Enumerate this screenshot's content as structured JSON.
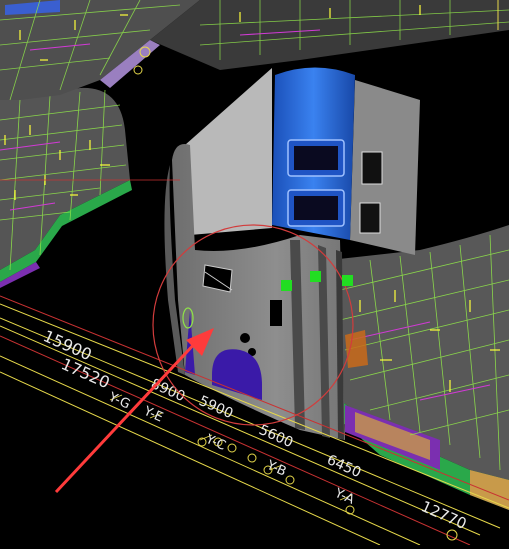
{
  "viewport": {
    "background": "#000000",
    "colors": {
      "slab_top": "#5a5a5a",
      "slab_edge_green": "#2ecc40",
      "grid_green": "#8fe34a",
      "grid_yellow": "#ffff3a",
      "grid_magenta": "#d23ad6",
      "wall_gray": "#8c8c8c",
      "wall_light": "#bdbdbd",
      "shaft_blue": "#2f6fe0",
      "dim_line_yellow": "#e6d84a",
      "grid_line_red": "#c83232",
      "selection_circle": "#d23c3c",
      "arrow": "#ff3b3b",
      "grip": "#22dd22"
    },
    "dimensions": [
      "15900",
      "17520",
      "8900",
      "5900",
      "5600",
      "6450",
      "12770"
    ],
    "axis_labels": [
      "Y-G",
      "Y-E",
      "Y-C",
      "Y-B",
      "Y-A"
    ],
    "grip_count": 3
  }
}
